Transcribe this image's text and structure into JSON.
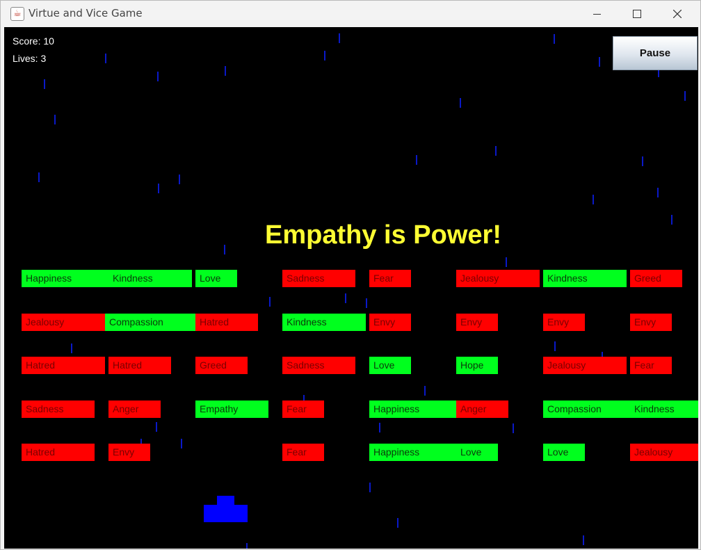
{
  "window": {
    "title": "Virtue and Vice Game",
    "app_icon": "java-cup-icon",
    "controls": [
      "minimize-icon",
      "maximize-icon",
      "close-icon"
    ]
  },
  "hud": {
    "score_text": "Score: 10",
    "lives_text": "Lives: 3",
    "score": 10,
    "lives": 3
  },
  "pause_button": {
    "label": "Pause"
  },
  "message": "Empathy is Power!",
  "colors": {
    "background": "#000000",
    "virtue": "#00ff1e",
    "vice": "#ff0000",
    "message": "#ffff33",
    "paddle": "#0000ff",
    "rain": "#0a19c8"
  },
  "blocks": {
    "row1": [
      "Happiness",
      "Kindness",
      "Love",
      "Sadness",
      "Fear",
      "Jealousy",
      "Kindness",
      "Greed"
    ],
    "row2": [
      "Jealousy",
      "Compassion",
      "Hatred",
      "Kindness",
      "Envy",
      "Envy",
      "Envy",
      "Envy"
    ],
    "row3": [
      "Hatred",
      "Hatred",
      "Greed",
      "Sadness",
      "Love",
      "Hope",
      "Jealousy",
      "Fear"
    ],
    "row4": [
      "Sadness",
      "Anger",
      "Empathy",
      "Fear",
      "Happiness",
      "Anger",
      "Compassion",
      "Kindness"
    ],
    "row5": [
      "Hatred",
      "Envy",
      "Fear",
      "Happiness",
      "Love",
      "Love",
      "Jealousy"
    ]
  }
}
